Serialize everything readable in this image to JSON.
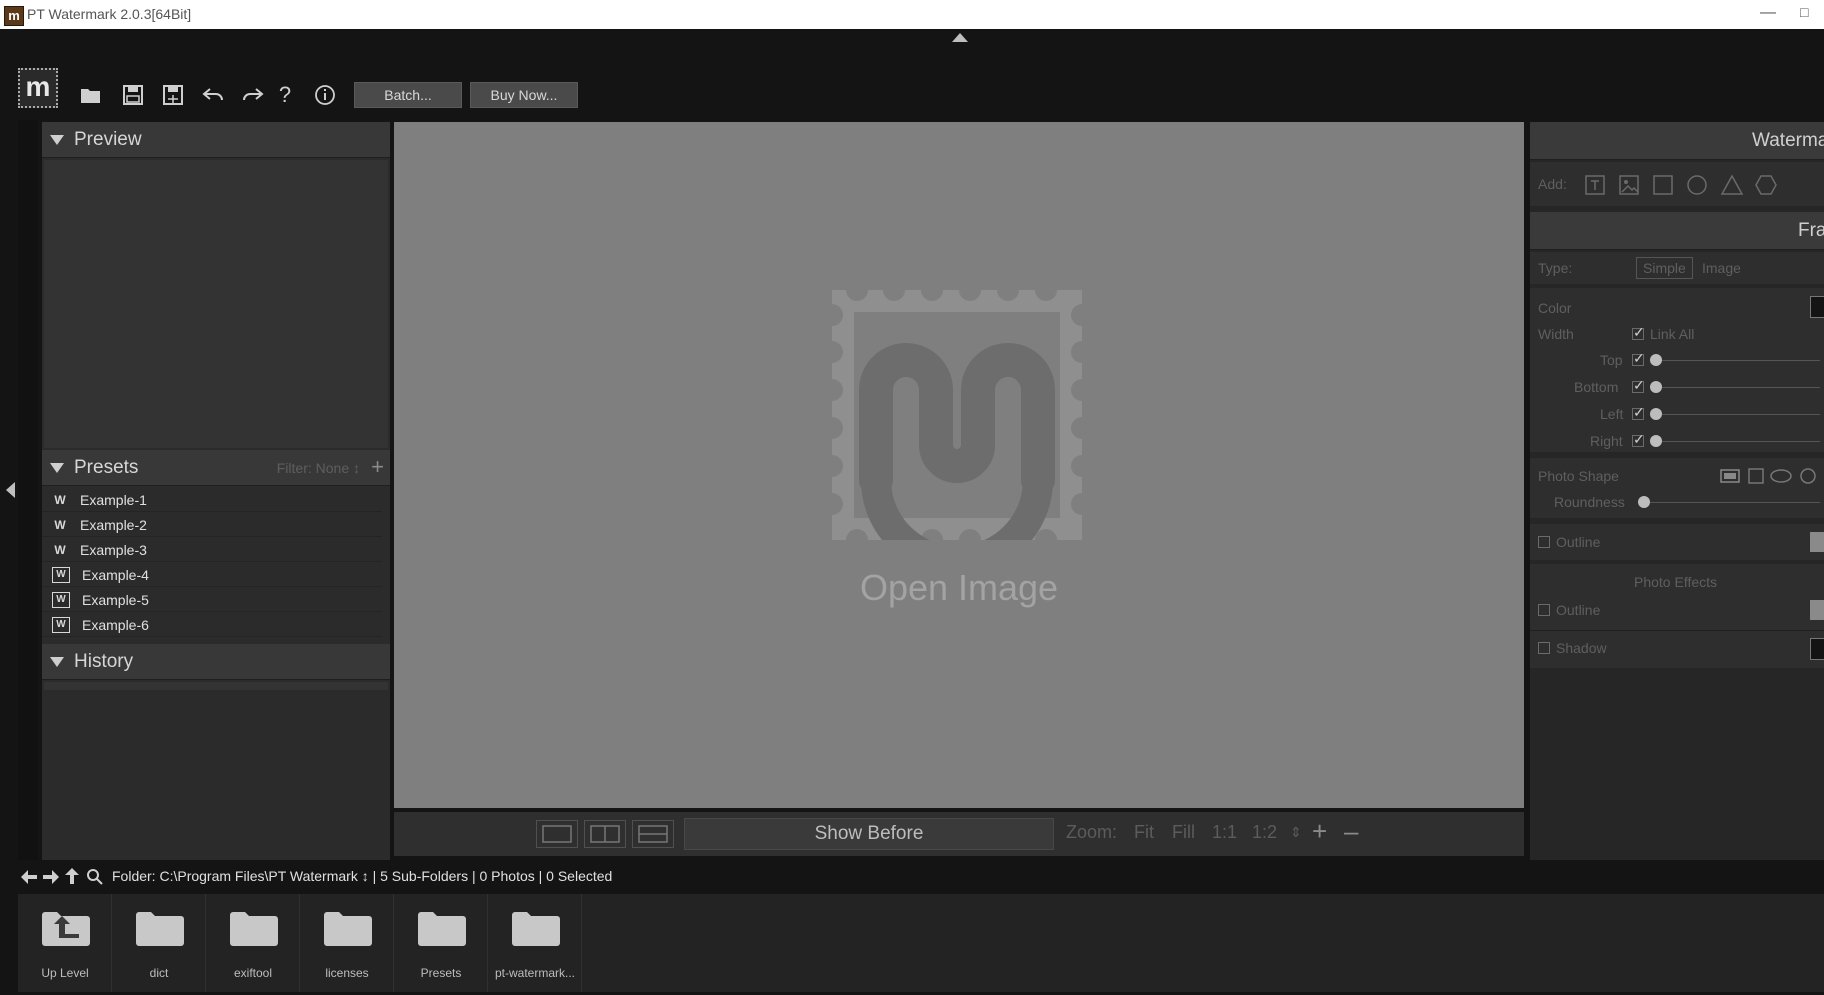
{
  "window": {
    "title": "PT Watermark 2.0.3[64Bit]",
    "icon": "app-logo-icon"
  },
  "toolbar": {
    "logo_text": "m",
    "icons": [
      "open-folder-icon",
      "save-icon",
      "save-as-icon",
      "undo-icon",
      "redo-icon",
      "help-icon",
      "info-icon"
    ],
    "batch_label": "Batch...",
    "buy_label": "Buy Now..."
  },
  "left": {
    "preview": {
      "title": "Preview"
    },
    "presets": {
      "title": "Presets",
      "filter": "Filter: None ↕",
      "add": "+",
      "items": [
        {
          "label": "Example-1",
          "icon": "W"
        },
        {
          "label": "Example-2",
          "icon": "W"
        },
        {
          "label": "Example-3",
          "icon": "W"
        },
        {
          "label": "Example-4",
          "icon": "W"
        },
        {
          "label": "Example-5",
          "icon": "W"
        },
        {
          "label": "Example-6",
          "icon": "W"
        }
      ]
    },
    "history": {
      "title": "History"
    }
  },
  "canvas": {
    "open_label": "Open Image"
  },
  "viewbar": {
    "show_before": "Show Before",
    "zoom_label": "Zoom:",
    "zoom_fit": "Fit",
    "zoom_fill": "Fill",
    "zoom_1_1": "1:1",
    "zoom_1_2": "1:2",
    "zoom_in": "+",
    "zoom_out": "–"
  },
  "right": {
    "watermark": {
      "title": "Watermark",
      "add_label": "Add:"
    },
    "frame": {
      "title": "Frame",
      "type_label": "Type:",
      "type_simple": "Simple",
      "type_image": "Image",
      "color_label": "Color",
      "width_label": "Width",
      "link_all": "Link All",
      "top": "Top",
      "bottom": "Bottom",
      "left": "Left",
      "right": "Right",
      "photo_shape": "Photo Shape",
      "roundness": "Roundness",
      "outline": "Outline",
      "photo_effects": "Photo Effects",
      "effects_outline": "Outline",
      "shadow": "Shadow"
    }
  },
  "pathbar": {
    "path_text": "Folder:  C:\\Program Files\\PT Watermark ↕ | 5 Sub-Folders | 0 Photos | 0 Selected"
  },
  "browser": {
    "items": [
      {
        "label": "Up Level"
      },
      {
        "label": "dict"
      },
      {
        "label": "exiftool"
      },
      {
        "label": "licenses"
      },
      {
        "label": "Presets"
      },
      {
        "label": "pt-watermark..."
      }
    ]
  },
  "colors": {
    "canvas": "#7f7f7f",
    "panel": "#2b2b2b",
    "background": "#141414"
  }
}
